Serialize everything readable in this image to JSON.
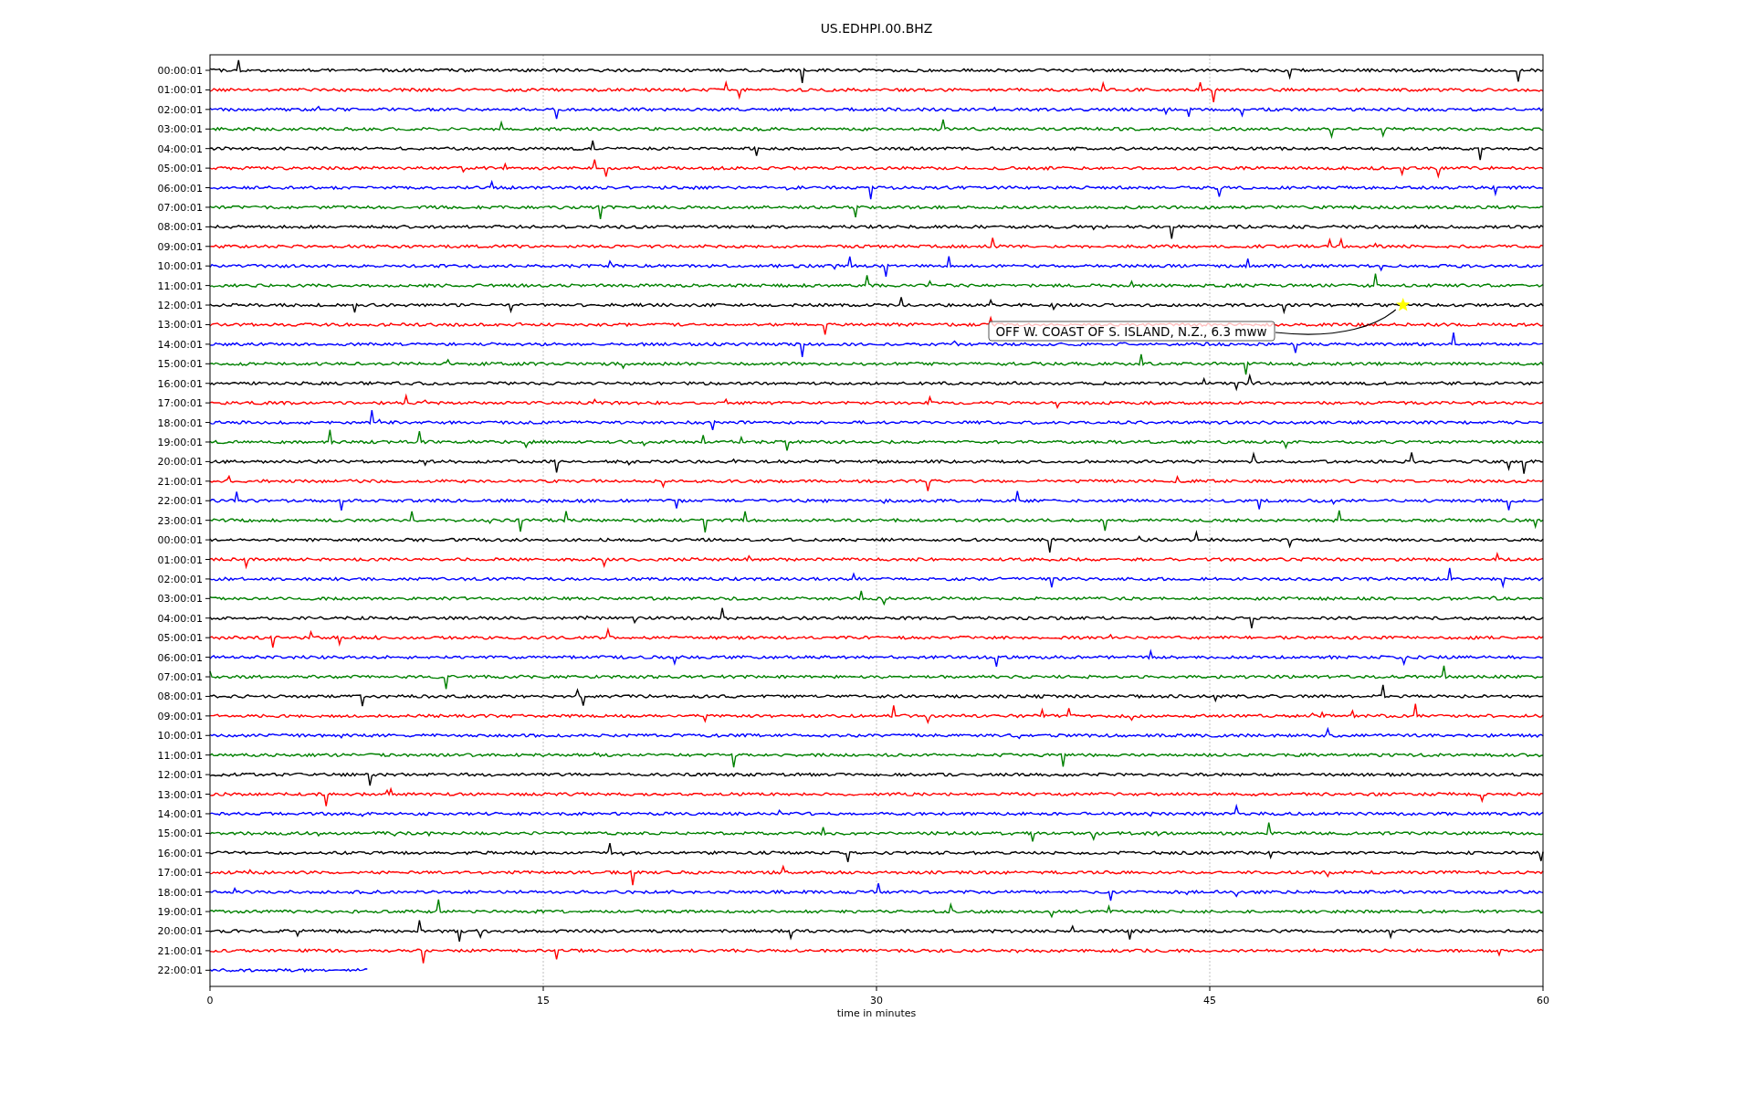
{
  "title": "US.EDHPI.00.BHZ",
  "rows": [
    {
      "label": "00:00:01",
      "color": "#000000",
      "level": 1
    },
    {
      "label": "01:00:01",
      "color": "#ff0000",
      "level": 1
    },
    {
      "label": "02:00:01",
      "color": "#0000ff",
      "level": 1
    },
    {
      "label": "03:00:01",
      "color": "#008000",
      "level": 1
    },
    {
      "label": "04:00:01",
      "color": "#000000",
      "level": 1
    },
    {
      "label": "05:00:01",
      "color": "#ff0000",
      "level": 1
    },
    {
      "label": "06:00:01",
      "color": "#0000ff",
      "level": 1
    },
    {
      "label": "07:00:01",
      "color": "#008000",
      "level": 1
    },
    {
      "label": "08:00:01",
      "color": "#000000",
      "level": 1
    },
    {
      "label": "09:00:01",
      "color": "#ff0000",
      "level": 1
    },
    {
      "label": "10:00:01",
      "color": "#0000ff",
      "level": 1
    },
    {
      "label": "11:00:01",
      "color": "#008000",
      "level": 1
    },
    {
      "label": "12:00:01",
      "color": "#000000",
      "level": 1
    },
    {
      "label": "13:00:01",
      "color": "#ff0000",
      "level": 1
    },
    {
      "label": "14:00:01",
      "color": "#0000ff",
      "level": 1
    },
    {
      "label": "15:00:01",
      "color": "#008000",
      "level": 1
    },
    {
      "label": "16:00:01",
      "color": "#000000",
      "level": 1
    },
    {
      "label": "17:00:01",
      "color": "#ff0000",
      "level": 1
    },
    {
      "label": "18:00:01",
      "color": "#0000ff",
      "level": 1
    },
    {
      "label": "19:00:01",
      "color": "#008000",
      "level": 1
    },
    {
      "label": "20:00:01",
      "color": "#000000",
      "level": 1
    },
    {
      "label": "21:00:01",
      "color": "#ff0000",
      "level": 1
    },
    {
      "label": "22:00:01",
      "color": "#0000ff",
      "level": 1
    },
    {
      "label": "23:00:01",
      "color": "#008000",
      "level": 1
    },
    {
      "label": "00:00:01",
      "color": "#000000",
      "level": 1
    },
    {
      "label": "01:00:01",
      "color": "#ff0000",
      "level": 1
    },
    {
      "label": "02:00:01",
      "color": "#0000ff",
      "level": 1
    },
    {
      "label": "03:00:01",
      "color": "#008000",
      "level": 1
    },
    {
      "label": "04:00:01",
      "color": "#000000",
      "level": 1
    },
    {
      "label": "05:00:01",
      "color": "#ff0000",
      "level": 1
    },
    {
      "label": "06:00:01",
      "color": "#0000ff",
      "level": 1
    },
    {
      "label": "07:00:01",
      "color": "#008000",
      "level": 1
    },
    {
      "label": "08:00:01",
      "color": "#000000",
      "level": 1
    },
    {
      "label": "09:00:01",
      "color": "#ff0000",
      "level": 1
    },
    {
      "label": "10:00:01",
      "color": "#0000ff",
      "level": 1
    },
    {
      "label": "11:00:01",
      "color": "#008000",
      "level": 1
    },
    {
      "label": "12:00:01",
      "color": "#000000",
      "level": 1
    },
    {
      "label": "13:00:01",
      "color": "#ff0000",
      "level": 1
    },
    {
      "label": "14:00:01",
      "color": "#0000ff",
      "level": 1
    },
    {
      "label": "15:00:01",
      "color": "#008000",
      "level": 1
    },
    {
      "label": "16:00:01",
      "color": "#000000",
      "level": 1
    },
    {
      "label": "17:00:01",
      "color": "#ff0000",
      "level": 1
    },
    {
      "label": "18:00:01",
      "color": "#0000ff",
      "level": 1
    },
    {
      "label": "19:00:01",
      "color": "#008000",
      "level": 1
    },
    {
      "label": "20:00:01",
      "color": "#000000",
      "level": 1
    },
    {
      "label": "21:00:01",
      "color": "#ff0000",
      "level": 1
    },
    {
      "label": "22:00:01",
      "color": "#0000ff",
      "level": 0.118
    }
  ],
  "xticks": [
    "0",
    "15",
    "30",
    "45",
    "60"
  ],
  "xlabel": "time in minutes",
  "annotation": "OFF W. COAST OF S. ISLAND, N.Z., 6.3 mww"
}
